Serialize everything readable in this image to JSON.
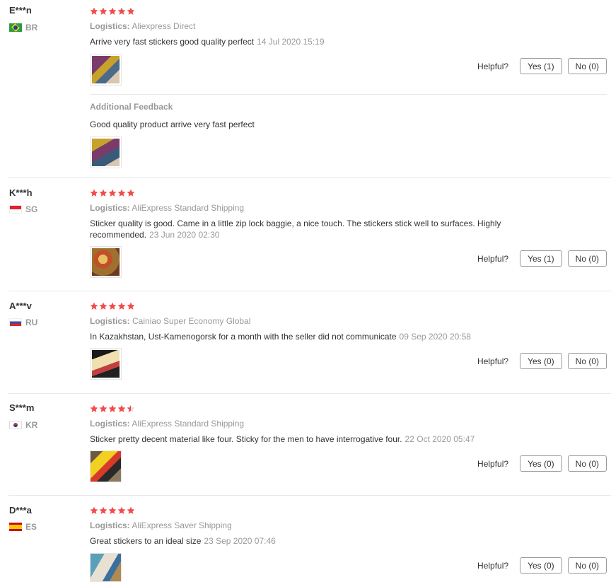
{
  "helpful_label": "Helpful?",
  "additional_feedback_title": "Additional Feedback",
  "logistics_label": "Logistics:",
  "star_color": "#f44a4a",
  "reviews": [
    {
      "user": "E***n",
      "country": "BR",
      "stars": 5,
      "logistics": "Aliexpress Direct",
      "feedback": "Arrive very fast stickers good quality perfect",
      "date": "14 Jul 2020 15:19",
      "yes": "Yes (1)",
      "no": "No (0)",
      "additional": "Good quality product arrive very fast perfect"
    },
    {
      "user": "K***h",
      "country": "SG",
      "stars": 5,
      "logistics": "AliExpress Standard Shipping",
      "feedback": "Sticker quality is good. Came in a little zip lock baggie, a nice touch. The stickers stick well to surfaces. Highly recommended.",
      "date": "23 Jun 2020 02:30",
      "yes": "Yes (1)",
      "no": "No (0)"
    },
    {
      "user": "A***v",
      "country": "RU",
      "stars": 5,
      "logistics": "Cainiao Super Economy Global",
      "feedback": "In Kazakhstan, Ust-Kamenogorsk for a month with the seller did not communicate",
      "date": "09 Sep 2020 20:58",
      "yes": "Yes (0)",
      "no": "No (0)"
    },
    {
      "user": "S***m",
      "country": "KR",
      "stars": 4.5,
      "logistics": "AliExpress Standard Shipping",
      "feedback": "Sticker pretty decent material like four. Sticky for the men to have interrogative four.",
      "date": "22 Oct 2020 05:47",
      "yes": "Yes (0)",
      "no": "No (0)"
    },
    {
      "user": "D***a",
      "country": "ES",
      "stars": 5,
      "logistics": "AliExpress Saver Shipping",
      "feedback": "Great stickers to an ideal size",
      "date": "23 Sep 2020 07:46",
      "yes": "Yes (0)",
      "no": "No (0)"
    }
  ]
}
